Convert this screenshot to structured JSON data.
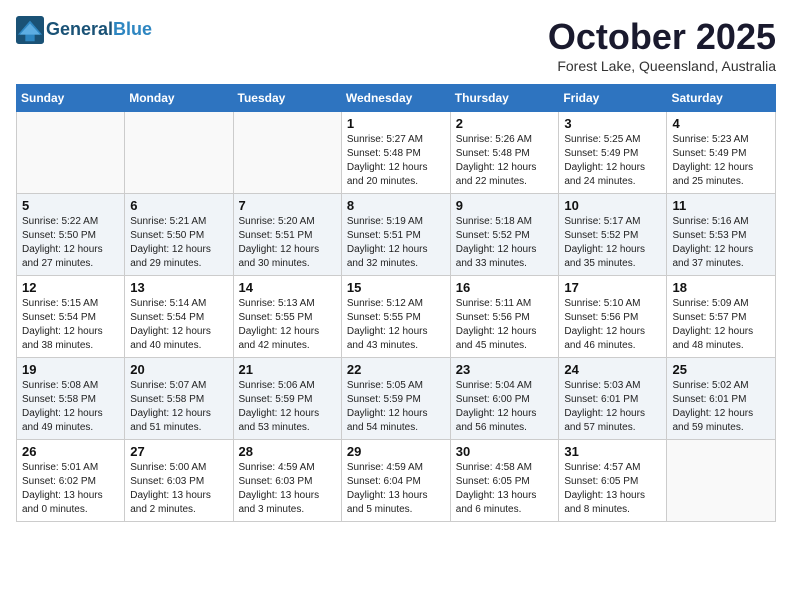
{
  "header": {
    "logo_line1": "General",
    "logo_line2": "Blue",
    "month": "October 2025",
    "location": "Forest Lake, Queensland, Australia"
  },
  "days_of_week": [
    "Sunday",
    "Monday",
    "Tuesday",
    "Wednesday",
    "Thursday",
    "Friday",
    "Saturday"
  ],
  "weeks": [
    {
      "shaded": false,
      "days": [
        {
          "num": "",
          "info": ""
        },
        {
          "num": "",
          "info": ""
        },
        {
          "num": "",
          "info": ""
        },
        {
          "num": "1",
          "info": "Sunrise: 5:27 AM\nSunset: 5:48 PM\nDaylight: 12 hours\nand 20 minutes."
        },
        {
          "num": "2",
          "info": "Sunrise: 5:26 AM\nSunset: 5:48 PM\nDaylight: 12 hours\nand 22 minutes."
        },
        {
          "num": "3",
          "info": "Sunrise: 5:25 AM\nSunset: 5:49 PM\nDaylight: 12 hours\nand 24 minutes."
        },
        {
          "num": "4",
          "info": "Sunrise: 5:23 AM\nSunset: 5:49 PM\nDaylight: 12 hours\nand 25 minutes."
        }
      ]
    },
    {
      "shaded": true,
      "days": [
        {
          "num": "5",
          "info": "Sunrise: 5:22 AM\nSunset: 5:50 PM\nDaylight: 12 hours\nand 27 minutes."
        },
        {
          "num": "6",
          "info": "Sunrise: 5:21 AM\nSunset: 5:50 PM\nDaylight: 12 hours\nand 29 minutes."
        },
        {
          "num": "7",
          "info": "Sunrise: 5:20 AM\nSunset: 5:51 PM\nDaylight: 12 hours\nand 30 minutes."
        },
        {
          "num": "8",
          "info": "Sunrise: 5:19 AM\nSunset: 5:51 PM\nDaylight: 12 hours\nand 32 minutes."
        },
        {
          "num": "9",
          "info": "Sunrise: 5:18 AM\nSunset: 5:52 PM\nDaylight: 12 hours\nand 33 minutes."
        },
        {
          "num": "10",
          "info": "Sunrise: 5:17 AM\nSunset: 5:52 PM\nDaylight: 12 hours\nand 35 minutes."
        },
        {
          "num": "11",
          "info": "Sunrise: 5:16 AM\nSunset: 5:53 PM\nDaylight: 12 hours\nand 37 minutes."
        }
      ]
    },
    {
      "shaded": false,
      "days": [
        {
          "num": "12",
          "info": "Sunrise: 5:15 AM\nSunset: 5:54 PM\nDaylight: 12 hours\nand 38 minutes."
        },
        {
          "num": "13",
          "info": "Sunrise: 5:14 AM\nSunset: 5:54 PM\nDaylight: 12 hours\nand 40 minutes."
        },
        {
          "num": "14",
          "info": "Sunrise: 5:13 AM\nSunset: 5:55 PM\nDaylight: 12 hours\nand 42 minutes."
        },
        {
          "num": "15",
          "info": "Sunrise: 5:12 AM\nSunset: 5:55 PM\nDaylight: 12 hours\nand 43 minutes."
        },
        {
          "num": "16",
          "info": "Sunrise: 5:11 AM\nSunset: 5:56 PM\nDaylight: 12 hours\nand 45 minutes."
        },
        {
          "num": "17",
          "info": "Sunrise: 5:10 AM\nSunset: 5:56 PM\nDaylight: 12 hours\nand 46 minutes."
        },
        {
          "num": "18",
          "info": "Sunrise: 5:09 AM\nSunset: 5:57 PM\nDaylight: 12 hours\nand 48 minutes."
        }
      ]
    },
    {
      "shaded": true,
      "days": [
        {
          "num": "19",
          "info": "Sunrise: 5:08 AM\nSunset: 5:58 PM\nDaylight: 12 hours\nand 49 minutes."
        },
        {
          "num": "20",
          "info": "Sunrise: 5:07 AM\nSunset: 5:58 PM\nDaylight: 12 hours\nand 51 minutes."
        },
        {
          "num": "21",
          "info": "Sunrise: 5:06 AM\nSunset: 5:59 PM\nDaylight: 12 hours\nand 53 minutes."
        },
        {
          "num": "22",
          "info": "Sunrise: 5:05 AM\nSunset: 5:59 PM\nDaylight: 12 hours\nand 54 minutes."
        },
        {
          "num": "23",
          "info": "Sunrise: 5:04 AM\nSunset: 6:00 PM\nDaylight: 12 hours\nand 56 minutes."
        },
        {
          "num": "24",
          "info": "Sunrise: 5:03 AM\nSunset: 6:01 PM\nDaylight: 12 hours\nand 57 minutes."
        },
        {
          "num": "25",
          "info": "Sunrise: 5:02 AM\nSunset: 6:01 PM\nDaylight: 12 hours\nand 59 minutes."
        }
      ]
    },
    {
      "shaded": false,
      "days": [
        {
          "num": "26",
          "info": "Sunrise: 5:01 AM\nSunset: 6:02 PM\nDaylight: 13 hours\nand 0 minutes."
        },
        {
          "num": "27",
          "info": "Sunrise: 5:00 AM\nSunset: 6:03 PM\nDaylight: 13 hours\nand 2 minutes."
        },
        {
          "num": "28",
          "info": "Sunrise: 4:59 AM\nSunset: 6:03 PM\nDaylight: 13 hours\nand 3 minutes."
        },
        {
          "num": "29",
          "info": "Sunrise: 4:59 AM\nSunset: 6:04 PM\nDaylight: 13 hours\nand 5 minutes."
        },
        {
          "num": "30",
          "info": "Sunrise: 4:58 AM\nSunset: 6:05 PM\nDaylight: 13 hours\nand 6 minutes."
        },
        {
          "num": "31",
          "info": "Sunrise: 4:57 AM\nSunset: 6:05 PM\nDaylight: 13 hours\nand 8 minutes."
        },
        {
          "num": "",
          "info": ""
        }
      ]
    }
  ]
}
